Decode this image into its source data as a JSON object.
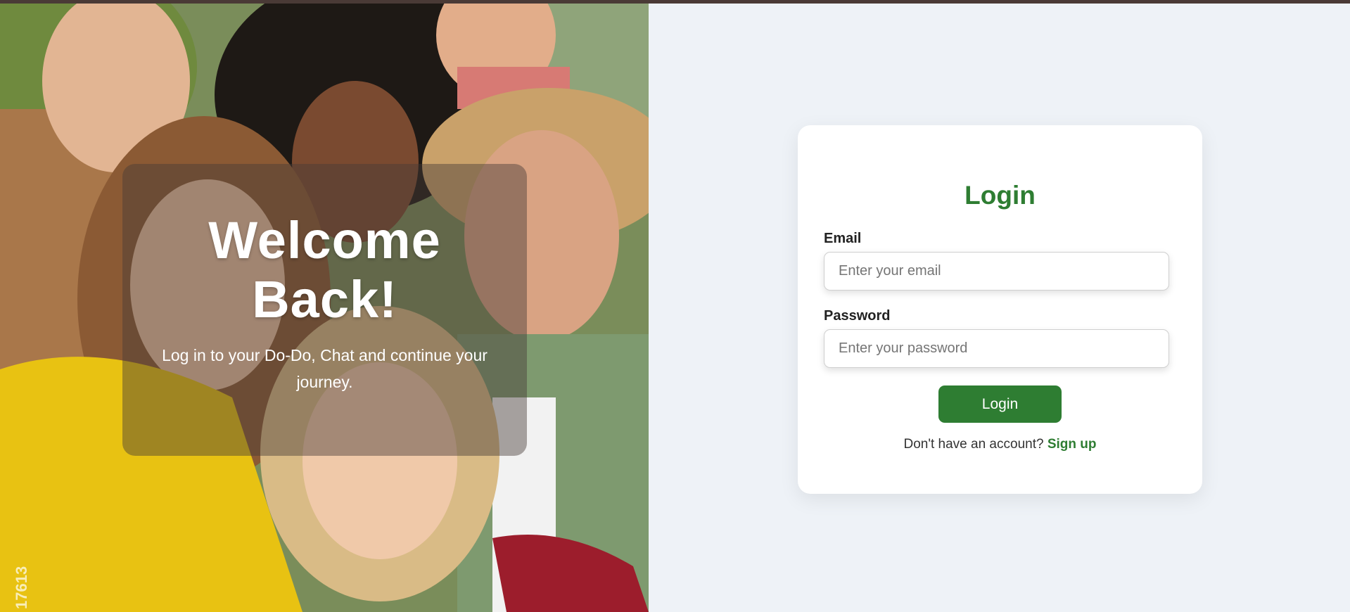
{
  "hero": {
    "title": "Welcome Back!",
    "subtitle": "Log in to your Do-Do, Chat and continue your journey.",
    "watermark": "17613"
  },
  "login": {
    "title": "Login",
    "email_label": "Email",
    "email_placeholder": "Enter your email",
    "email_value": "",
    "password_label": "Password",
    "password_placeholder": "Enter your password",
    "password_value": "",
    "submit_label": "Login",
    "signup_prompt": "Don't have an account?",
    "signup_link": "Sign up"
  },
  "colors": {
    "accent": "#2e7d32",
    "page_background": "#eef2f7",
    "card_background": "#ffffff",
    "top_bar": "#4a3a36"
  }
}
